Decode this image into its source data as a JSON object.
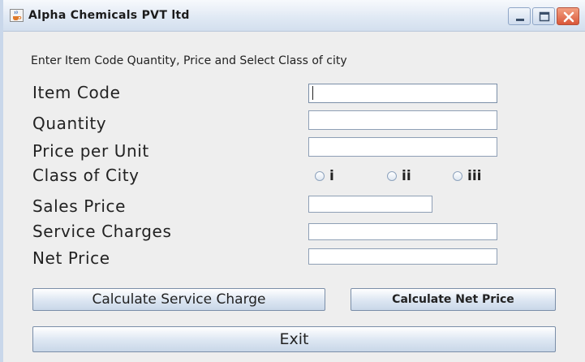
{
  "window": {
    "title": "Alpha Chemicals PVT ltd",
    "controls": [
      "minimize",
      "maximize",
      "close"
    ]
  },
  "form": {
    "instruction": "Enter Item Code Quantity, Price and Select Class of city",
    "labels": {
      "item_code": "Item Code",
      "quantity": "Quantity",
      "price_per_unit": "Price per Unit",
      "class_of_city": "Class of City",
      "sales_price": "Sales Price",
      "service_charges": "Service Charges",
      "net_price": "Net Price"
    },
    "values": {
      "item_code": "",
      "quantity": "",
      "price_per_unit": "",
      "sales_price": "",
      "service_charges": "",
      "net_price": ""
    },
    "city_options": [
      "i",
      "ii",
      "iii"
    ],
    "buttons": {
      "calc_service": "Calculate Service Charge",
      "calc_net": "Calculate Net Price",
      "exit": "Exit"
    }
  },
  "icons": {
    "app": "java-cup-icon",
    "minimize": "minimize-icon",
    "maximize": "maximize-icon",
    "close": "close-icon"
  },
  "colors": {
    "title_bar": "#dfe8f4",
    "close_button": "#d9573a",
    "panel_background": "#eeeeee"
  }
}
